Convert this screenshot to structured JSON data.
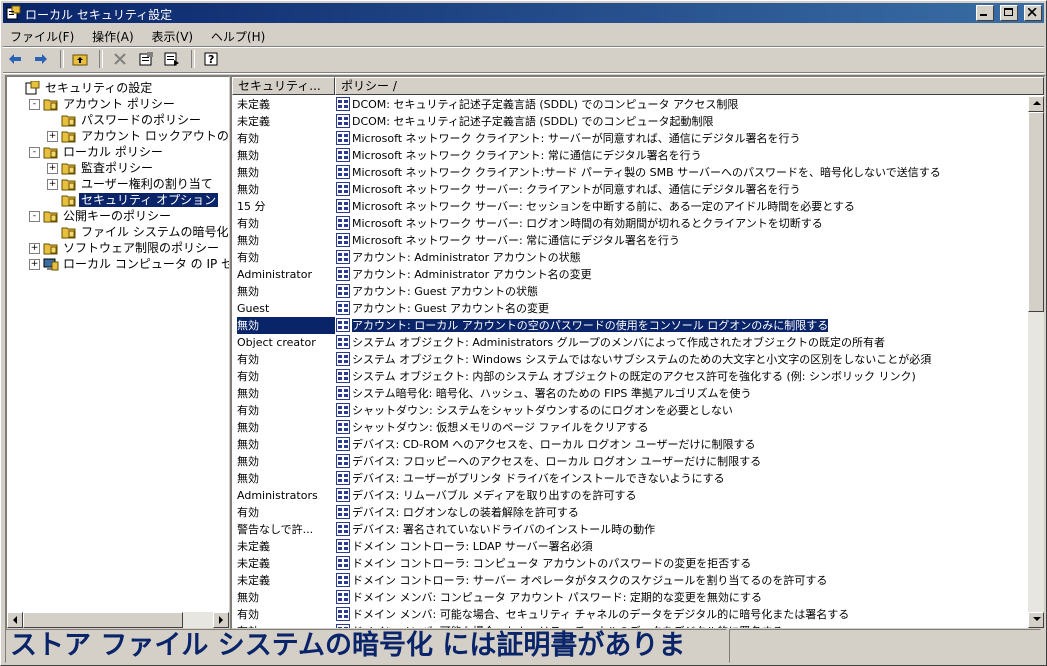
{
  "window": {
    "title": "ローカル セキュリティ設定"
  },
  "menu": [
    "ファイル(F)",
    "操作(A)",
    "表示(V)",
    "ヘルプ(H)"
  ],
  "toolbar": [
    "back-icon",
    "forward-icon",
    "up-folder-icon",
    "delete-icon",
    "properties-icon",
    "export-list-icon",
    "help-icon"
  ],
  "tree": [
    {
      "label": "セキュリティの設定",
      "level": 0,
      "icon": "security-settings-icon",
      "exp": ""
    },
    {
      "label": "アカウント ポリシー",
      "level": 1,
      "icon": "folder-icon",
      "exp": "-"
    },
    {
      "label": "パスワードのポリシー",
      "level": 2,
      "icon": "folder-icon",
      "exp": ""
    },
    {
      "label": "アカウント ロックアウトのポ",
      "level": 2,
      "icon": "folder-icon",
      "exp": "+"
    },
    {
      "label": "ローカル ポリシー",
      "level": 1,
      "icon": "folder-icon",
      "exp": "-"
    },
    {
      "label": "監査ポリシー",
      "level": 2,
      "icon": "folder-icon",
      "exp": "+"
    },
    {
      "label": "ユーザー権利の割り当て",
      "level": 2,
      "icon": "folder-icon",
      "exp": "+"
    },
    {
      "label": "セキュリティ オプション",
      "level": 2,
      "icon": "folder-icon",
      "exp": "",
      "selected": true
    },
    {
      "label": "公開キーのポリシー",
      "level": 1,
      "icon": "folder-icon",
      "exp": "-"
    },
    {
      "label": "ファイル システムの暗号化",
      "level": 2,
      "icon": "folder-icon",
      "exp": ""
    },
    {
      "label": "ソフトウェア制限のポリシー",
      "level": 1,
      "icon": "folder-icon",
      "exp": "+"
    },
    {
      "label": "ローカル コンピュータ の IP セ",
      "level": 1,
      "icon": "ip-security-icon",
      "exp": "+"
    }
  ],
  "list": {
    "columns": [
      "セキュリティ...",
      "ポリシー /"
    ],
    "rows": [
      {
        "setting": "未定義",
        "policy": "DCOM: セキュリティ記述子定義言語 (SDDL) でのコンピュータ アクセス制限"
      },
      {
        "setting": "未定義",
        "policy": "DCOM: セキュリティ記述子定義言語 (SDDL) でのコンピュータ起動制限"
      },
      {
        "setting": "有効",
        "policy": "Microsoft ネットワーク クライアント: サーバーが同意すれば、通信にデジタル署名を行う"
      },
      {
        "setting": "無効",
        "policy": "Microsoft ネットワーク クライアント: 常に通信にデジタル署名を行う"
      },
      {
        "setting": "無効",
        "policy": "Microsoft ネットワーク クライアント:サード パーティ製の SMB サーバーへのパスワードを、暗号化しないで送信する"
      },
      {
        "setting": "無効",
        "policy": "Microsoft ネットワーク サーバー: クライアントが同意すれば、通信にデジタル署名を行う"
      },
      {
        "setting": "15 分",
        "policy": "Microsoft ネットワーク サーバー: セッションを中断する前に、ある一定のアイドル時間を必要とする"
      },
      {
        "setting": "有効",
        "policy": "Microsoft ネットワーク サーバー: ログオン時間の有効期間が切れるとクライアントを切断する"
      },
      {
        "setting": "無効",
        "policy": "Microsoft ネットワーク サーバー: 常に通信にデジタル署名を行う"
      },
      {
        "setting": "有効",
        "policy": "アカウント: Administrator アカウントの状態"
      },
      {
        "setting": "Administrator",
        "policy": "アカウント: Administrator アカウント名の変更"
      },
      {
        "setting": "無効",
        "policy": "アカウント: Guest アカウントの状態"
      },
      {
        "setting": "Guest",
        "policy": "アカウント: Guest アカウント名の変更"
      },
      {
        "setting": "無効",
        "policy": "アカウント: ローカル アカウントの空のパスワードの使用をコンソール ログオンのみに制限する",
        "selected": true
      },
      {
        "setting": "Object creator",
        "policy": "システム オブジェクト: Administrators グループのメンバによって作成されたオブジェクトの既定の所有者"
      },
      {
        "setting": "有効",
        "policy": "システム オブジェクト: Windows システムではないサブシステムのための大文字と小文字の区別をしないことが必須"
      },
      {
        "setting": "有効",
        "policy": "システム オブジェクト: 内部のシステム オブジェクトの既定のアクセス許可を強化する (例: シンボリック リンク)"
      },
      {
        "setting": "無効",
        "policy": "システム暗号化: 暗号化、ハッシュ、署名のための FIPS 準拠アルゴリズムを使う"
      },
      {
        "setting": "有効",
        "policy": "シャットダウン: システムをシャットダウンするのにログオンを必要としない"
      },
      {
        "setting": "無効",
        "policy": "シャットダウン: 仮想メモリのページ ファイルをクリアする"
      },
      {
        "setting": "無効",
        "policy": "デバイス: CD-ROM へのアクセスを、ローカル ログオン ユーザーだけに制限する"
      },
      {
        "setting": "無効",
        "policy": "デバイス: フロッピーへのアクセスを、ローカル ログオン ユーザーだけに制限する"
      },
      {
        "setting": "無効",
        "policy": "デバイス: ユーザーがプリンタ ドライバをインストールできないようにする"
      },
      {
        "setting": "Administrators",
        "policy": "デバイス: リムーバブル メディアを取り出すのを許可する"
      },
      {
        "setting": "有効",
        "policy": "デバイス: ログオンなしの装着解除を許可する"
      },
      {
        "setting": "警告なしで許...",
        "policy": "デバイス: 署名されていないドライバのインストール時の動作"
      },
      {
        "setting": "未定義",
        "policy": "ドメイン コントローラ: LDAP サーバー署名必須"
      },
      {
        "setting": "未定義",
        "policy": "ドメイン コントローラ: コンピュータ アカウントのパスワードの変更を拒否する"
      },
      {
        "setting": "未定義",
        "policy": "ドメイン コントローラ: サーバー オペレータがタスクのスケジュールを割り当てるのを許可する"
      },
      {
        "setting": "無効",
        "policy": "ドメイン メンバ: コンピュータ アカウント パスワード: 定期的な変更を無効にする"
      },
      {
        "setting": "有効",
        "policy": "ドメイン メンバ: 可能な場合、セキュリティ チャネルのデータをデジタル的に暗号化または署名する"
      },
      {
        "setting": "有効",
        "policy": "ドメイン メンバ: 可能な場合、セキュリティ チャネルのデータをデジタル的に署名する"
      }
    ]
  },
  "status": {
    "text": "ストア ファイル システムの暗号化 には証明書がありま"
  },
  "colors": {
    "title_start": "#0a246a",
    "title_end": "#3a6ea5",
    "selection": "#0a246a",
    "face": "#d4d0c8"
  }
}
